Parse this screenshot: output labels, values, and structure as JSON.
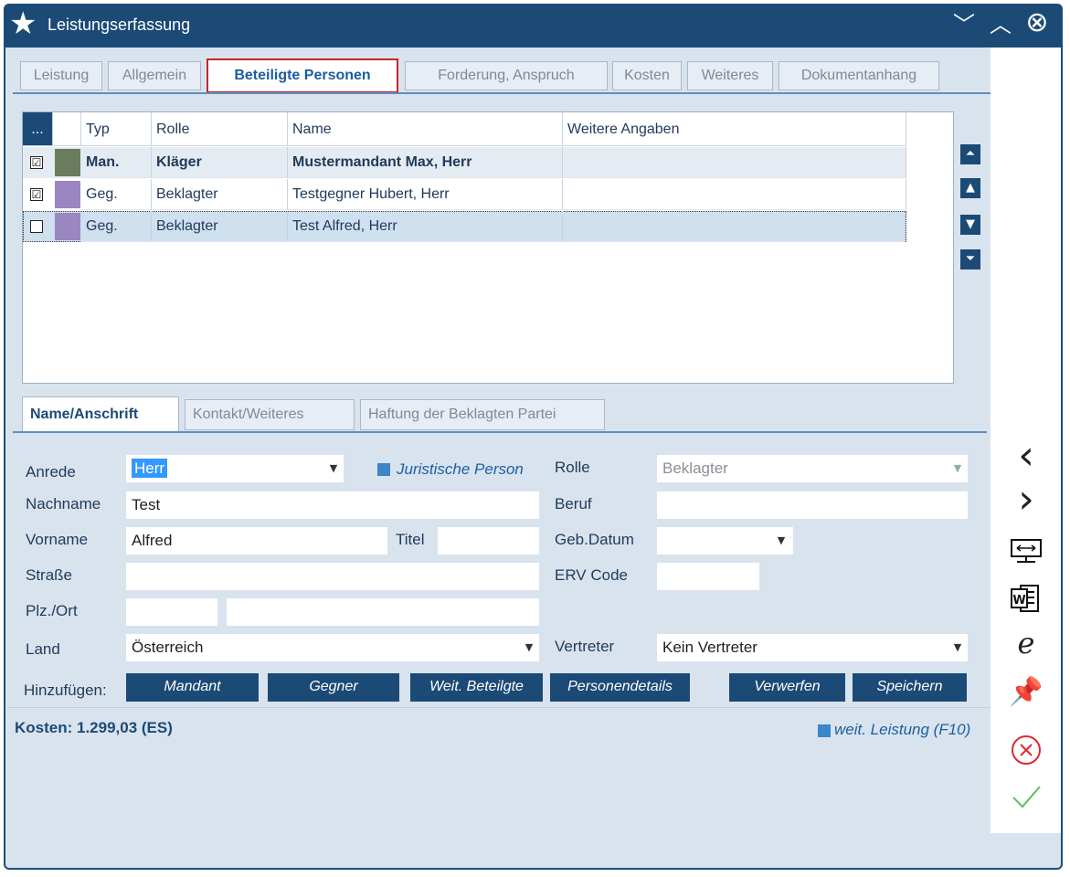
{
  "window": {
    "title": "Leistungserfassung",
    "controls": [
      "﹀",
      "︿",
      "⊗"
    ]
  },
  "tabs": [
    {
      "label": "Leistung"
    },
    {
      "label": "Allgemein"
    },
    {
      "label": "Beteiligte Personen",
      "active": true
    },
    {
      "label": "Forderung, Anspruch"
    },
    {
      "label": "Kosten"
    },
    {
      "label": "Weiteres"
    },
    {
      "label": "Dokumentanhang"
    }
  ],
  "grid": {
    "headers": [
      "...",
      "",
      "Typ",
      "Rolle",
      "Name",
      "Weitere Angaben"
    ],
    "rows": [
      {
        "checked": true,
        "check": "☑",
        "color": "#6b7b5e",
        "typ": "Man.",
        "rolle": "Kläger",
        "name": "Mustermandant Max, Herr",
        "weitere": "",
        "bold": true
      },
      {
        "checked": true,
        "check": "☑",
        "color": "#9a86c0",
        "typ": "Geg.",
        "rolle": "Beklagter",
        "name": "Testgegner Hubert, Herr",
        "weitere": ""
      },
      {
        "checked": false,
        "check": "",
        "color": "#9a86c0",
        "typ": "Geg.",
        "rolle": "Beklagter",
        "name": "Test Alfred, Herr",
        "weitere": "",
        "selected": true
      }
    ]
  },
  "subtabs": [
    {
      "label": "Name/Anschrift",
      "active": true
    },
    {
      "label": "Kontakt/Weiteres"
    },
    {
      "label": "Haftung der Beklagten Partei"
    }
  ],
  "form": {
    "anrede_label": "Anrede",
    "anrede_value": "Herr",
    "juristische_label": "Juristische Person",
    "nachname_label": "Nachname",
    "nachname_value": "Test",
    "vorname_label": "Vorname",
    "vorname_value": "Alfred",
    "titel_label": "Titel",
    "titel_value": "",
    "strasse_label": "Straße",
    "strasse_value": "",
    "plzort_label": "Plz./Ort",
    "plz_value": "",
    "ort_value": "",
    "land_label": "Land",
    "land_value": "Österreich",
    "rolle_label": "Rolle",
    "rolle_value": "Beklagter",
    "beruf_label": "Beruf",
    "beruf_value": "",
    "gebdatum_label": "Geb.Datum",
    "gebdatum_value": "",
    "erv_label": "ERV Code",
    "erv_value": "",
    "vertreter_label": "Vertreter",
    "vertreter_value": "Kein Vertreter"
  },
  "actions": {
    "hinzufuegen_label": "Hinzufügen:",
    "mandant": "Mandant",
    "gegner": "Gegner",
    "weit_beteiligte": "Weit. Beteilgte",
    "personendetails": "Personendetails",
    "verwerfen": "Verwerfen",
    "speichern": "Speichern"
  },
  "footer": {
    "kosten": "Kosten: 1.299,03 (ES)",
    "weit_leistung": "weit. Leistung (F10)"
  },
  "side_icons": [
    "chevron-left-icon",
    "chevron-right-icon",
    "monitor-icon",
    "word-icon",
    "internet-explorer-icon",
    "pin-icon",
    "cancel-icon",
    "confirm-check-icon"
  ],
  "colors": {
    "titlebar": "#1c4a76",
    "accent_red": "#c8252b",
    "body": "#d9e3ee"
  }
}
